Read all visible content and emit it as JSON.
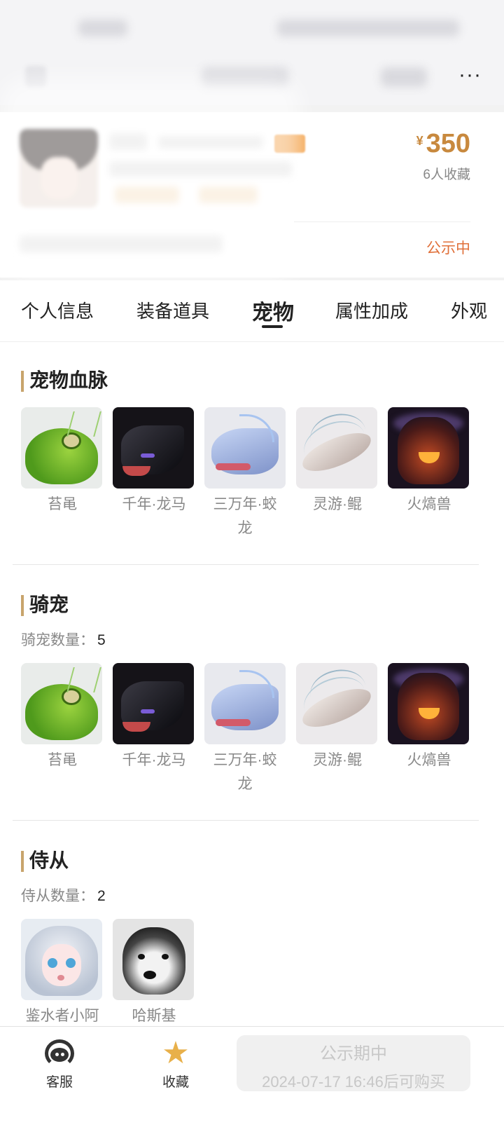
{
  "header": {
    "more_label": "···"
  },
  "listing": {
    "currency": "¥",
    "price": "350",
    "favorites": "6人收藏",
    "status": "公示中"
  },
  "tabs": [
    {
      "label": "个人信息",
      "active": false
    },
    {
      "label": "装备道具",
      "active": false
    },
    {
      "label": "宠物",
      "active": true
    },
    {
      "label": "属性加成",
      "active": false
    },
    {
      "label": "外观",
      "active": false
    }
  ],
  "sections": {
    "bloodline": {
      "title": "宠物血脉",
      "items": [
        {
          "name": "苔黾",
          "icon": "moss-toad"
        },
        {
          "name": "千年·龙马",
          "icon": "black-dragon"
        },
        {
          "name": "三万年·蛟龙",
          "icon": "white-dragon"
        },
        {
          "name": "灵游·鲲",
          "icon": "kun"
        },
        {
          "name": "火熇兽",
          "icon": "fire-beast"
        }
      ]
    },
    "mounts": {
      "title": "骑宠",
      "count_label": "骑宠数量：",
      "count": "5",
      "items": [
        {
          "name": "苔黾",
          "icon": "moss-toad"
        },
        {
          "name": "千年·龙马",
          "icon": "black-dragon"
        },
        {
          "name": "三万年·蛟龙",
          "icon": "white-dragon"
        },
        {
          "name": "灵游·鲲",
          "icon": "kun"
        },
        {
          "name": "火熇兽",
          "icon": "fire-beast"
        }
      ]
    },
    "followers": {
      "title": "侍从",
      "count_label": "侍从数量：",
      "count": "2",
      "items": [
        {
          "name": "鉴水者小阿",
          "icon": "silver-hair-girl"
        },
        {
          "name": "哈斯基",
          "icon": "husky"
        }
      ]
    }
  },
  "bottom_bar": {
    "service_label": "客服",
    "favorite_label": "收藏",
    "buy_line1": "公示期中",
    "buy_line2": "2024-07-17 16:46后可购买"
  },
  "colors": {
    "price": "#c8893e",
    "status": "#e0703a",
    "accent_bar": "#c8a46c",
    "star": "#e8b04a"
  }
}
